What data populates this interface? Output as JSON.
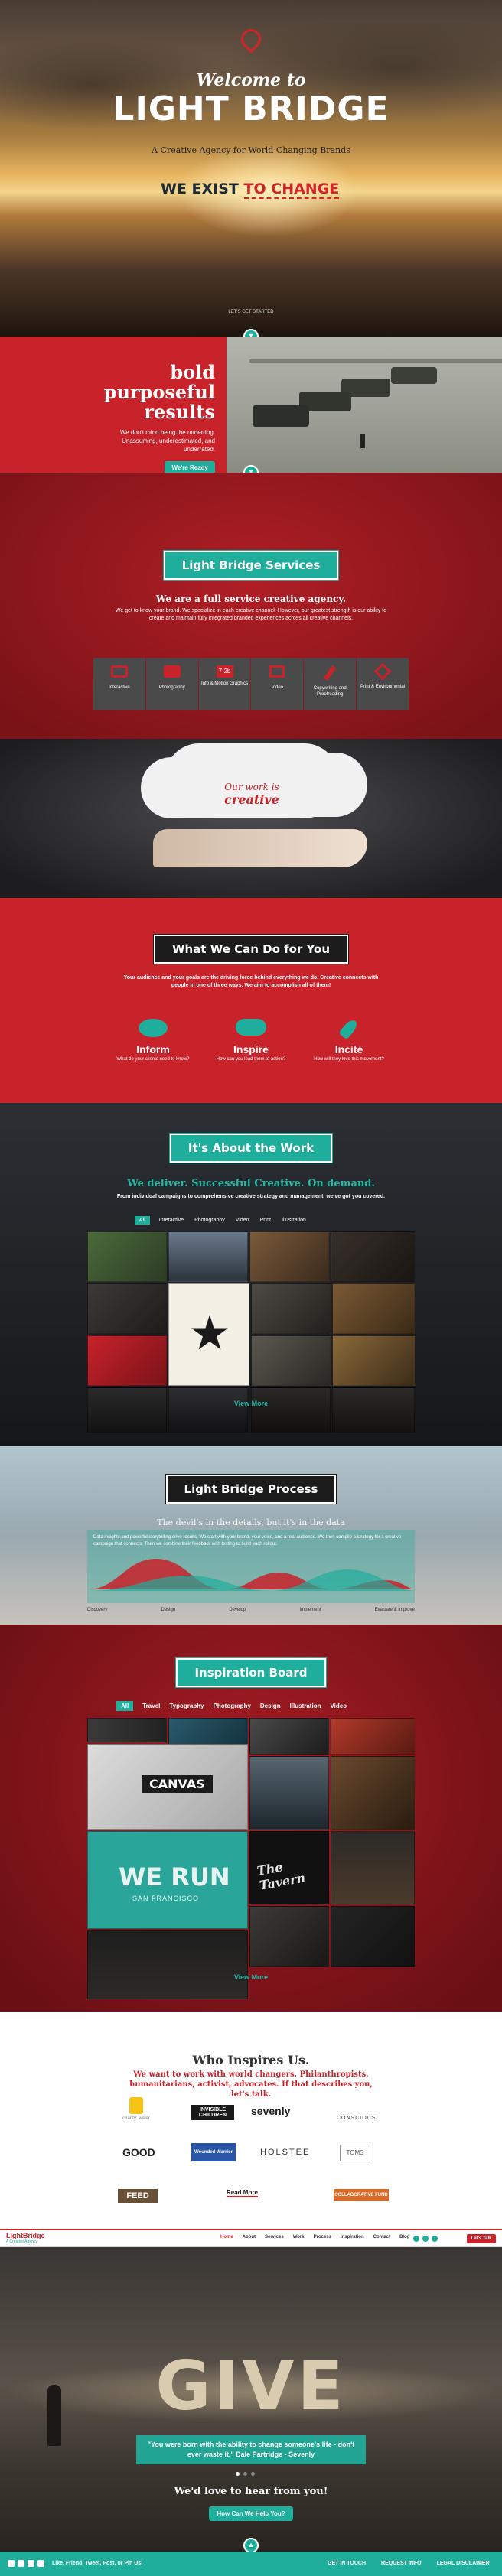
{
  "hero": {
    "welcome": "Welcome to",
    "brand": "LIGHT BRIDGE",
    "tagline": "A Creative Agency for World Changing Brands",
    "exist_prefix": "WE EXIST",
    "exist_word": "TO CHANGE",
    "scroll_label": "LET'S GET STARTED"
  },
  "bold": {
    "title": [
      "bold",
      "purposeful",
      "results"
    ],
    "body": "We don't mind being the underdog. Unassuming, underestimated, and underrated.",
    "button": "We're Ready"
  },
  "services": {
    "ribbon": "Light Bridge Services",
    "headline": "We are a full service creative agency.",
    "body": "We get to know your brand. We specialize in each creative channel. However, our greatest strength is our ability to create and maintain fully integrated branded experiences across all creative channels.",
    "items": [
      {
        "label": "Interactive",
        "icon": "monitor-icon"
      },
      {
        "label": "Photography",
        "icon": "camera-icon"
      },
      {
        "label": "Info & Motion Graphics",
        "icon": "film-icon"
      },
      {
        "label": "Video",
        "icon": "video-icon"
      },
      {
        "label": "Copywriting and Proofreading",
        "icon": "pencil-icon"
      },
      {
        "label": "Print & Environmental",
        "icon": "tag-icon"
      }
    ]
  },
  "cloud": {
    "line1": "Our work is",
    "line2": "creative"
  },
  "cando": {
    "ribbon": "What We Can Do for You",
    "body": "Your audience and your goals are the driving force behind everything we do. Creative connects with people in one of three ways. We aim to accomplish all of them!",
    "items": [
      {
        "label": "Inform",
        "sub": "What do your clients need to know?",
        "icon": "chat-icon"
      },
      {
        "label": "Inspire",
        "sub": "How can you lead them to action?",
        "icon": "cloud-icon"
      },
      {
        "label": "Incite",
        "sub": "How will they love this movement?",
        "icon": "rocket-icon"
      }
    ]
  },
  "work": {
    "ribbon": "It's About the Work",
    "headline": "We deliver. Successful Creative. On demand.",
    "body": "From individual campaigns to comprehensive creative strategy and management, we've got you covered.",
    "filters": [
      "All",
      "Interactive",
      "Photography",
      "Video",
      "Print",
      "Illustration"
    ],
    "more": "View More"
  },
  "process": {
    "ribbon": "Light Bridge Process",
    "subtitle": "The devil's in the details, but it's in the data",
    "body": "Data insights and powerful storytelling drive results. We start with your brand, your voice, and a real audience. We then compile a strategy for a creative campaign that connects. Then we combine their feedback with testing to build each rollout.",
    "steps": [
      "Discovery",
      "Design",
      "Develop",
      "Implement",
      "Evaluate & Improve"
    ]
  },
  "inspiration": {
    "ribbon": "Inspiration Board",
    "filters": [
      "All",
      "Travel",
      "Typography",
      "Photography",
      "Design",
      "Illustration",
      "Video"
    ],
    "tile_canvas": "CANVAS",
    "tile_werun": "WE RUN",
    "tile_werun_sub": "SAN FRANCISCO",
    "tile_tavern": "The Tavern",
    "more": "View More"
  },
  "inspires": {
    "title": "Who Inspires Us.",
    "body": "We want to work with world changers. Philanthropists, humanitarians, activist, advocates. If that describes you, let's talk.",
    "logos": [
      "charity: water",
      "INVISIBLE CHILDREN",
      "sevenly",
      "CONSCIOUS",
      "GOOD",
      "Wounded Warrior",
      "HOLSTEE",
      "TOMS",
      "FEED",
      "COLLABORATIVE FUND"
    ],
    "more": "Read More"
  },
  "navbar": {
    "logo_text": "LightBridge",
    "logo_sub": "A Creative Agency",
    "links": [
      "Home",
      "About",
      "Services",
      "Work",
      "Process",
      "Inspiration",
      "Contact",
      "Blog"
    ],
    "cta": "Let's Talk"
  },
  "give": {
    "word": "GIVE",
    "quote": "\"You were born with the ability to change someone's life - don't ever waste it.\" Dale Partridge - Sevenly",
    "hear": "We'd love to hear from you!",
    "button": "How Can We Help You?"
  },
  "footer": {
    "social_text": "Like, Friend, Tweet, Post, or Pin Us!",
    "links": [
      "GET IN TOUCH",
      "REQUEST INFO",
      "LEGAL DISCLAIMER"
    ]
  }
}
